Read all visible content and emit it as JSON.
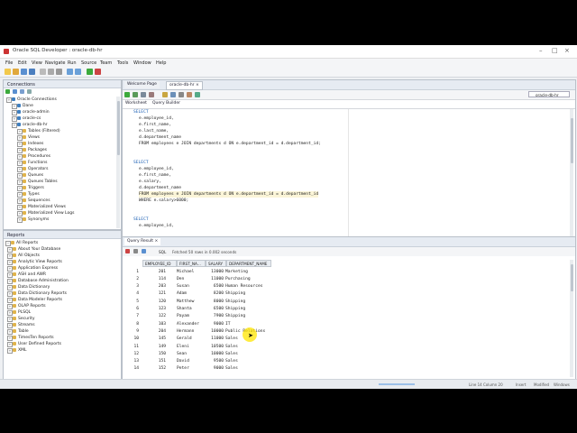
{
  "window": {
    "title": "Oracle SQL Developer : oracle-db-hr"
  },
  "menu": [
    "File",
    "Edit",
    "View",
    "Navigate",
    "Run",
    "Source",
    "Team",
    "Tools",
    "Window",
    "Help"
  ],
  "connections": {
    "header": "Connections",
    "items": [
      {
        "label": "Oracle Connections",
        "level": 0
      },
      {
        "label": "Dane",
        "level": 1
      },
      {
        "label": "oracle-admin",
        "level": 1
      },
      {
        "label": "oracle-cs",
        "level": 1
      },
      {
        "label": "oracle-db-hr",
        "level": 1
      },
      {
        "label": "Tables (Filtered)",
        "level": 2
      },
      {
        "label": "Views",
        "level": 2
      },
      {
        "label": "Indexes",
        "level": 2
      },
      {
        "label": "Packages",
        "level": 2
      },
      {
        "label": "Procedures",
        "level": 2
      },
      {
        "label": "Functions",
        "level": 2
      },
      {
        "label": "Operators",
        "level": 2
      },
      {
        "label": "Queues",
        "level": 2
      },
      {
        "label": "Queues Tables",
        "level": 2
      },
      {
        "label": "Triggers",
        "level": 2
      },
      {
        "label": "Types",
        "level": 2
      },
      {
        "label": "Sequences",
        "level": 2
      },
      {
        "label": "Materialized Views",
        "level": 2
      },
      {
        "label": "Materialized View Logs",
        "level": 2
      },
      {
        "label": "Synonyms",
        "level": 2
      }
    ]
  },
  "reports": {
    "header": "Reports",
    "items": [
      "All Reports",
      "About Your Database",
      "All Objects",
      "Analytic View Reports",
      "Application Express",
      "ASH and AWR",
      "Database Administration",
      "Data Dictionary",
      "Data Dictionary Reports",
      "Data Modeler Reports",
      "OLAP Reports",
      "PLSQL",
      "Security",
      "Streams",
      "Table",
      "TimesTen Reports",
      "User Defined Reports",
      "XML"
    ]
  },
  "editor": {
    "tabs": [
      "Welcome Page",
      "oracle-db-hr"
    ],
    "subtabs": [
      "Worksheet",
      "Query Builder"
    ],
    "connection_selector": "oracle-db-hr",
    "lines": [
      {
        "kw": "SELECT",
        "rest": ""
      },
      {
        "kw": "",
        "rest": "e.employee_id,"
      },
      {
        "kw": "",
        "rest": "e.first_name,"
      },
      {
        "kw": "",
        "rest": "e.last_name,"
      },
      {
        "kw": "",
        "rest": "d.department_name"
      },
      {
        "kw": "",
        "rest": "FROM employees e JOIN departments d ON e.department_id = d.department_id;"
      },
      {
        "kw": "",
        "rest": ""
      },
      {
        "kw": "",
        "rest": ""
      },
      {
        "kw": "SELECT",
        "rest": ""
      },
      {
        "kw": "",
        "rest": "e.employee_id,"
      },
      {
        "kw": "",
        "rest": "e.first_name,"
      },
      {
        "kw": "",
        "rest": "e.salary,"
      },
      {
        "kw": "",
        "rest": "d.department_name"
      },
      {
        "kw": "",
        "rest": "FROM employees e JOIN departments d ON e.department_id = d.department_id"
      },
      {
        "kw": "",
        "rest": "WHERE e.salary>6000;"
      },
      {
        "kw": "",
        "rest": ""
      },
      {
        "kw": "",
        "rest": ""
      },
      {
        "kw": "SELECT",
        "rest": ""
      },
      {
        "kw": "",
        "rest": "e.employee_id,"
      }
    ]
  },
  "result": {
    "tab": "Query Result",
    "sql_label": "SQL",
    "status": "Fetched 50 rows in 0.002 seconds",
    "columns": [
      "EMPLOYEE_ID",
      "FIRST_NA...",
      "SALARY",
      "DEPARTMENT_NAME"
    ],
    "rows": [
      [
        "1",
        "201",
        "Michael",
        "13000",
        "Marketing"
      ],
      [
        "2",
        "114",
        "Den",
        "11000",
        "Purchasing"
      ],
      [
        "3",
        "203",
        "Susan",
        "6500",
        "Human Resources"
      ],
      [
        "4",
        "121",
        "Adam",
        "8200",
        "Shipping"
      ],
      [
        "5",
        "120",
        "Matthew",
        "8000",
        "Shipping"
      ],
      [
        "6",
        "123",
        "Shanta",
        "6500",
        "Shipping"
      ],
      [
        "7",
        "122",
        "Payam",
        "7900",
        "Shipping"
      ],
      [
        "8",
        "103",
        "Alexander",
        "9000",
        "IT"
      ],
      [
        "9",
        "204",
        "Hermann",
        "10000",
        "Public Relations"
      ],
      [
        "10",
        "145",
        "Gerald",
        "11000",
        "Sales"
      ],
      [
        "11",
        "149",
        "Eleni",
        "10500",
        "Sales"
      ],
      [
        "12",
        "150",
        "Sean",
        "10000",
        "Sales"
      ],
      [
        "13",
        "151",
        "David",
        "9500",
        "Sales"
      ],
      [
        "14",
        "152",
        "Peter",
        "9000",
        "Sales"
      ]
    ]
  },
  "statusbar": {
    "position": "Line 14 Column 20",
    "mode": "Insert",
    "modified": "Modified",
    "os": "Windows"
  }
}
